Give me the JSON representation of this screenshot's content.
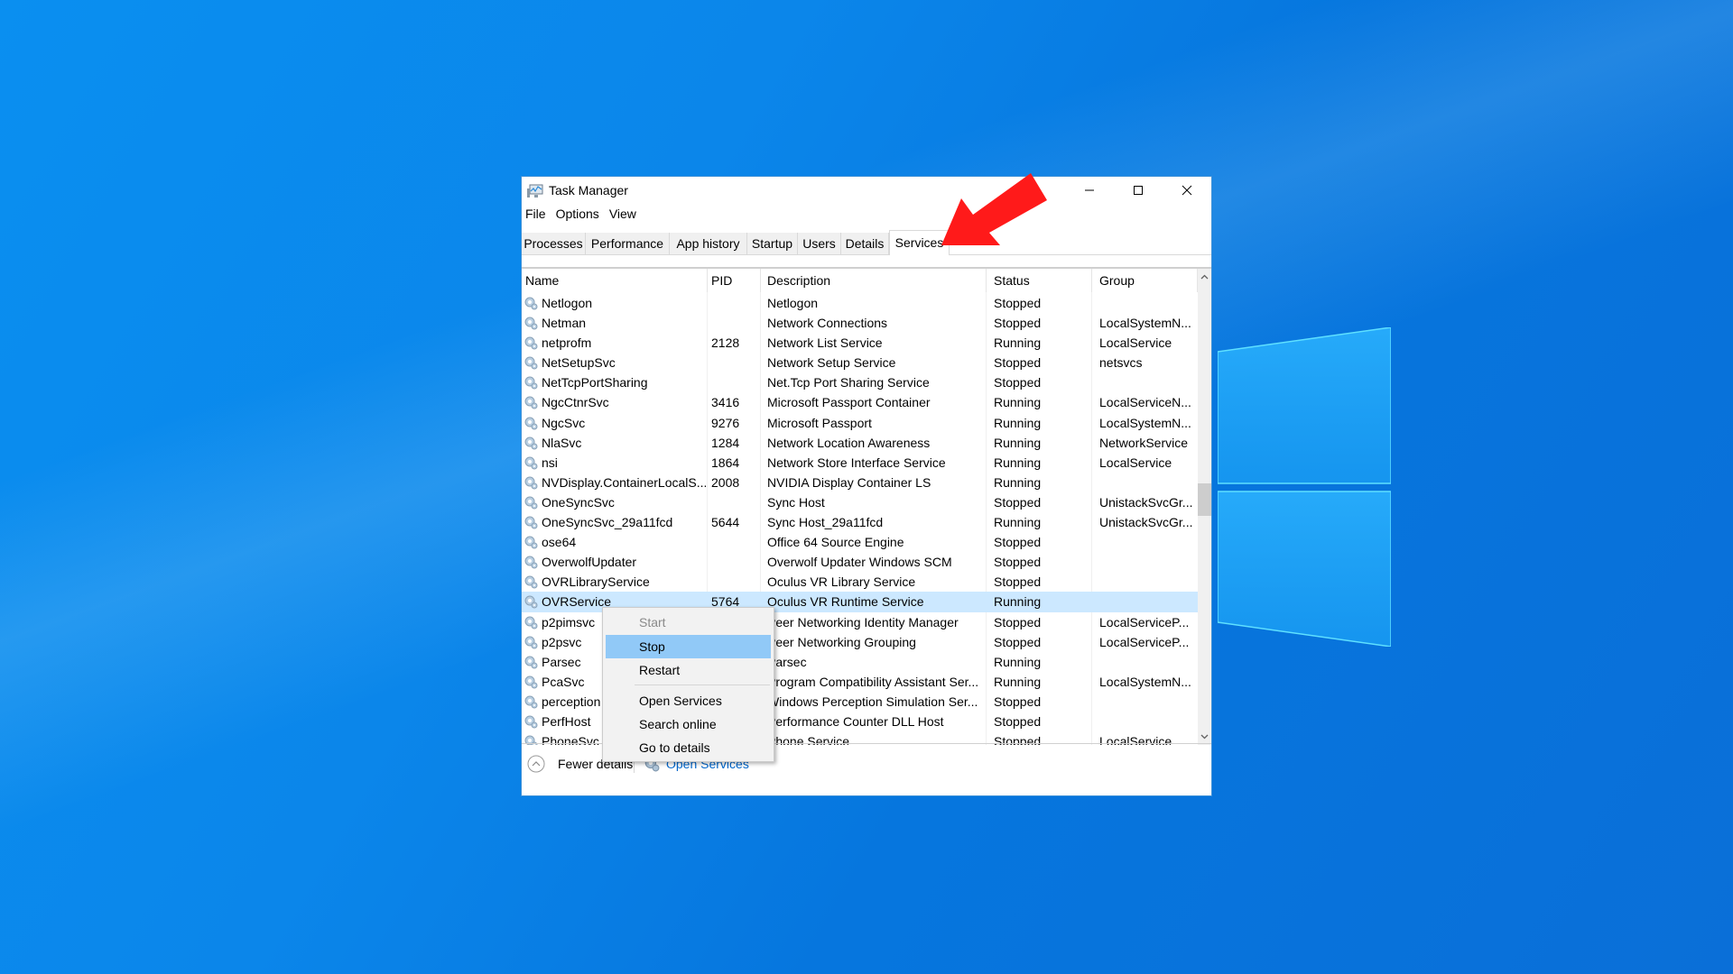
{
  "window": {
    "title": "Task Manager",
    "controls": {
      "minimize": "—",
      "maximize": "☐",
      "close": "✕"
    }
  },
  "menu": [
    "File",
    "Options",
    "View"
  ],
  "tabs": [
    {
      "label": "Processes",
      "active": false
    },
    {
      "label": "Performance",
      "active": false
    },
    {
      "label": "App history",
      "active": false
    },
    {
      "label": "Startup",
      "active": false
    },
    {
      "label": "Users",
      "active": false
    },
    {
      "label": "Details",
      "active": false
    },
    {
      "label": "Services",
      "active": true
    }
  ],
  "columns": [
    "Name",
    "PID",
    "Description",
    "Status",
    "Group"
  ],
  "sort": {
    "column": "Name",
    "direction": "ascending"
  },
  "rows": [
    {
      "name": "Netlogon",
      "pid": "",
      "description": "Netlogon",
      "status": "Stopped",
      "group": ""
    },
    {
      "name": "Netman",
      "pid": "",
      "description": "Network Connections",
      "status": "Stopped",
      "group": "LocalSystemN..."
    },
    {
      "name": "netprofm",
      "pid": "2128",
      "description": "Network List Service",
      "status": "Running",
      "group": "LocalService"
    },
    {
      "name": "NetSetupSvc",
      "pid": "",
      "description": "Network Setup Service",
      "status": "Stopped",
      "group": "netsvcs"
    },
    {
      "name": "NetTcpPortSharing",
      "pid": "",
      "description": "Net.Tcp Port Sharing Service",
      "status": "Stopped",
      "group": ""
    },
    {
      "name": "NgcCtnrSvc",
      "pid": "3416",
      "description": "Microsoft Passport Container",
      "status": "Running",
      "group": "LocalServiceN..."
    },
    {
      "name": "NgcSvc",
      "pid": "9276",
      "description": "Microsoft Passport",
      "status": "Running",
      "group": "LocalSystemN..."
    },
    {
      "name": "NlaSvc",
      "pid": "1284",
      "description": "Network Location Awareness",
      "status": "Running",
      "group": "NetworkService"
    },
    {
      "name": "nsi",
      "pid": "1864",
      "description": "Network Store Interface Service",
      "status": "Running",
      "group": "LocalService"
    },
    {
      "name": "NVDisplay.ContainerLocalS...",
      "pid": "2008",
      "description": "NVIDIA Display Container LS",
      "status": "Running",
      "group": ""
    },
    {
      "name": "OneSyncSvc",
      "pid": "",
      "description": "Sync Host",
      "status": "Stopped",
      "group": "UnistackSvcGr..."
    },
    {
      "name": "OneSyncSvc_29a11fcd",
      "pid": "5644",
      "description": "Sync Host_29a11fcd",
      "status": "Running",
      "group": "UnistackSvcGr..."
    },
    {
      "name": "ose64",
      "pid": "",
      "description": "Office 64 Source Engine",
      "status": "Stopped",
      "group": ""
    },
    {
      "name": "OverwolfUpdater",
      "pid": "",
      "description": "Overwolf Updater Windows SCM",
      "status": "Stopped",
      "group": ""
    },
    {
      "name": "OVRLibraryService",
      "pid": "",
      "description": "Oculus VR Library Service",
      "status": "Stopped",
      "group": ""
    },
    {
      "name": "OVRService",
      "pid": "5764",
      "description": "Oculus VR Runtime Service",
      "status": "Running",
      "group": "",
      "selected": true
    },
    {
      "name": "p2pimsvc",
      "pid": "",
      "description": "Peer Networking Identity Manager",
      "status": "Stopped",
      "group": "LocalServiceP..."
    },
    {
      "name": "p2psvc",
      "pid": "",
      "description": "Peer Networking Grouping",
      "status": "Stopped",
      "group": "LocalServiceP..."
    },
    {
      "name": "Parsec",
      "pid": "",
      "description": "Parsec",
      "status": "Running",
      "group": ""
    },
    {
      "name": "PcaSvc",
      "pid": "",
      "description": "Program Compatibility Assistant Ser...",
      "status": "Running",
      "group": "LocalSystemN..."
    },
    {
      "name": "perception",
      "pid": "",
      "description": "Windows Perception Simulation Ser...",
      "status": "Stopped",
      "group": ""
    },
    {
      "name": "PerfHost",
      "pid": "",
      "description": "Performance Counter DLL Host",
      "status": "Stopped",
      "group": ""
    },
    {
      "name": "PhoneSvc",
      "pid": "",
      "description": "Phone Service",
      "status": "Stopped",
      "group": "LocalService"
    }
  ],
  "context_menu": [
    {
      "label": "Start",
      "disabled": true
    },
    {
      "label": "Stop",
      "highlighted": true
    },
    {
      "label": "Restart"
    },
    {
      "separator": true
    },
    {
      "label": "Open Services"
    },
    {
      "label": "Search online"
    },
    {
      "label": "Go to details"
    }
  ],
  "footer": {
    "fewer_details": "Fewer details",
    "open_services": "Open Services"
  },
  "colors": {
    "selection": "#cce8ff",
    "menu_highlight": "#91c9f7",
    "link": "#0066cc",
    "annotation_arrow": "#ff1a1a"
  },
  "annotation": {
    "type": "arrow",
    "points_to": "Services tab"
  }
}
